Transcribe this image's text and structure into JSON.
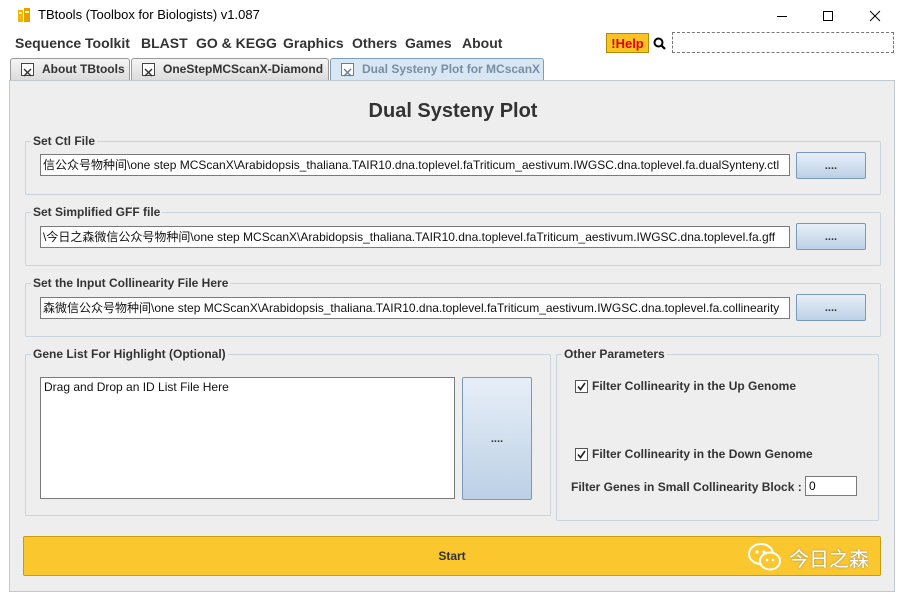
{
  "window": {
    "title": "TBtools (Toolbox for Biologists) v1.087",
    "app_icon": "tbtools-logo-icon",
    "controls": [
      "minimize-icon",
      "maximize-icon",
      "close-icon"
    ]
  },
  "menu": {
    "items": [
      "Sequence Toolkit",
      "BLAST",
      "GO & KEGG",
      "Graphics",
      "Others",
      "Games",
      "About"
    ],
    "help_label": "!Help",
    "search_icon": "search-icon",
    "search_value": ""
  },
  "tabs": [
    {
      "label": "About TBtools",
      "active": false
    },
    {
      "label": "OneStepMCScanX-Diamond",
      "active": false
    },
    {
      "label": "Dual Systeny Plot for MCscanX",
      "active": true
    }
  ],
  "main": {
    "heading": "Dual Systeny Plot",
    "ctl": {
      "title": "Set Ctl File",
      "value": "信公众号物种间\\one step MCScanX\\Arabidopsis_thaliana.TAIR10.dna.toplevel.faTriticum_aestivum.IWGSC.dna.toplevel.fa.dualSynteny.ctl",
      "button": "...."
    },
    "gff": {
      "title": "Set Simplified GFF file",
      "value": "\\今日之森微信公众号物种间\\one step MCScanX\\Arabidopsis_thaliana.TAIR10.dna.toplevel.faTriticum_aestivum.IWGSC.dna.toplevel.fa.gff",
      "button": "...."
    },
    "collinearity": {
      "title": "Set the Input Collinearity File Here",
      "value": "森微信公众号物种间\\one step MCScanX\\Arabidopsis_thaliana.TAIR10.dna.toplevel.faTriticum_aestivum.IWGSC.dna.toplevel.fa.collinearity",
      "button": "...."
    },
    "gene_list": {
      "title": "Gene List For Highlight (Optional)",
      "placeholder": "Drag and Drop an ID List File Here",
      "button": "...."
    },
    "other": {
      "title": "Other Parameters",
      "filter_up": {
        "label": "Filter Collinearity in the Up Genome",
        "checked": true
      },
      "filter_down": {
        "label": "Filter Collinearity in the Down Genome",
        "checked": true
      },
      "small_block_label": "Filter Genes in Small Collinearity Block :",
      "small_block_value": "0"
    },
    "start_label": "Start",
    "watermark": {
      "icon": "wechat-icon",
      "text": "今日之森"
    }
  },
  "colors": {
    "accent": "#fbc72f",
    "help_bg": "#f9c423",
    "help_text": "#e00000",
    "panel_bg": "#eeeeee",
    "button_blue": "#bcd0e6"
  }
}
